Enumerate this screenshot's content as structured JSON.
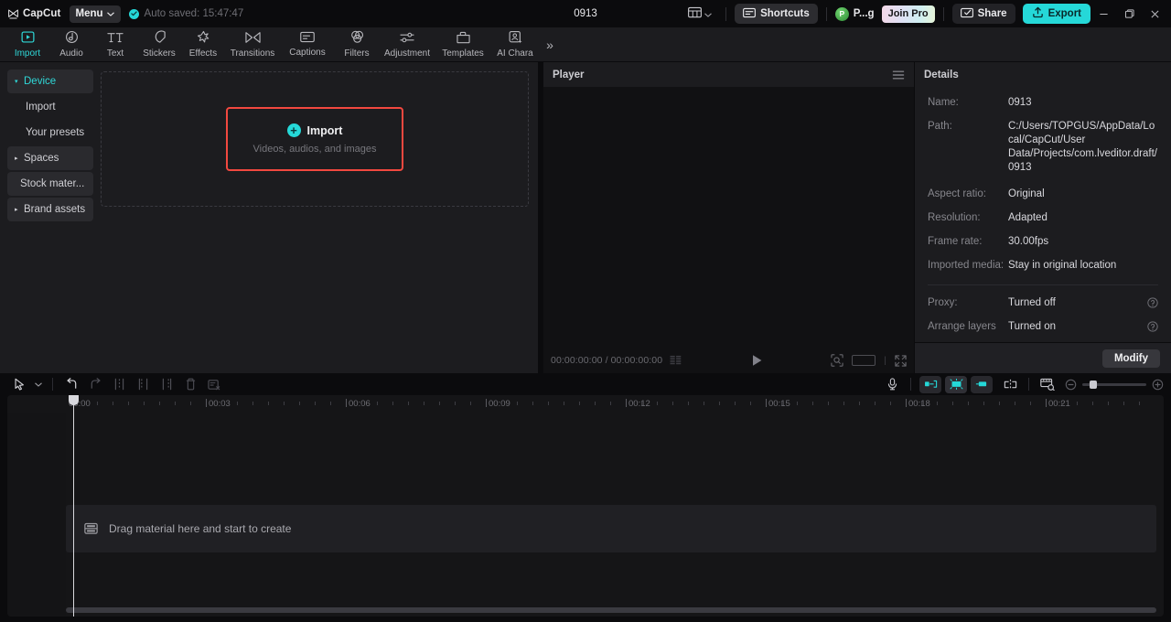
{
  "titlebar": {
    "brand": "CapCut",
    "menu_label": "Menu",
    "autosave_text": "Auto saved: 15:47:47",
    "project_title": "0913",
    "layout_icon": "layout-grid-icon",
    "shortcuts_label": "Shortcuts",
    "profile_initial": "P",
    "profile_name": "P...g",
    "join_pro_label": "Join Pro",
    "share_label": "Share",
    "export_label": "Export",
    "minimize_label": "—",
    "maximize_label": "❐",
    "close_label": "✕"
  },
  "rail": {
    "items": [
      {
        "label": "Import",
        "icon": "import-icon",
        "active": true
      },
      {
        "label": "Audio",
        "icon": "audio-icon",
        "active": false
      },
      {
        "label": "Text",
        "icon": "text-icon",
        "active": false
      },
      {
        "label": "Stickers",
        "icon": "stickers-icon",
        "active": false
      },
      {
        "label": "Effects",
        "icon": "effects-icon",
        "active": false
      },
      {
        "label": "Transitions",
        "icon": "transitions-icon",
        "active": false
      },
      {
        "label": "Captions",
        "icon": "captions-icon",
        "active": false
      },
      {
        "label": "Filters",
        "icon": "filters-icon",
        "active": false
      },
      {
        "label": "Adjustment",
        "icon": "adjustment-icon",
        "active": false
      },
      {
        "label": "Templates",
        "icon": "templates-icon",
        "active": false
      },
      {
        "label": "AI Chara",
        "icon": "ai-character-icon",
        "active": false
      }
    ],
    "more_label": "»"
  },
  "sidebar": {
    "items": [
      {
        "label": "Device",
        "type": "group",
        "expanded": true,
        "selected": true,
        "caret": "▾"
      },
      {
        "label": "Import",
        "type": "sub",
        "expanded": false,
        "selected": false,
        "caret": ""
      },
      {
        "label": "Your presets",
        "type": "sub",
        "expanded": false,
        "selected": false,
        "caret": ""
      },
      {
        "label": "Spaces",
        "type": "group",
        "expanded": false,
        "selected": false,
        "caret": "▸"
      },
      {
        "label": "Stock mater...",
        "type": "groupsub",
        "expanded": false,
        "selected": false,
        "caret": ""
      },
      {
        "label": "Brand assets",
        "type": "group",
        "expanded": false,
        "selected": false,
        "caret": "▸"
      }
    ]
  },
  "import_panel": {
    "button_label": "Import",
    "hint": "Videos, audios, and images",
    "plus_glyph": "+",
    "highlight_color": "#f2483f"
  },
  "player": {
    "title": "Player",
    "menu_icon": "hamburger-icon",
    "current_time": "00:00:00:00",
    "total_time": "00:00:00:00",
    "time_display": "00:00:00:00 / 00:00:00:00",
    "play_icon": "play-icon",
    "quality_icon": "quality-icon",
    "zoom_fit_icon": "zoom-fit-icon",
    "ratio_icon": "aspect-ratio-icon",
    "fullscreen_icon": "fullscreen-icon"
  },
  "details": {
    "title": "Details",
    "rows": [
      {
        "key": "Name:",
        "value": "0913",
        "help": false
      },
      {
        "key": "Path:",
        "value": "C:/Users/TOPGUS/AppData/Local/CapCut/User Data/Projects/com.lveditor.draft/0913",
        "help": false
      },
      {
        "key": "Aspect ratio:",
        "value": "Original",
        "help": false
      },
      {
        "key": "Resolution:",
        "value": "Adapted",
        "help": false
      },
      {
        "key": "Frame rate:",
        "value": "30.00fps",
        "help": false
      },
      {
        "key": "Imported media:",
        "value": "Stay in original location",
        "help": false
      }
    ],
    "rows2": [
      {
        "key": "Proxy:",
        "value": "Turned off",
        "help": true
      },
      {
        "key": "Arrange layers",
        "value": "Turned on",
        "help": true
      }
    ],
    "modify_label": "Modify"
  },
  "timeline": {
    "select_icon": "cursor-select-icon",
    "dropdown_icon": "chevron-down-icon",
    "undo_icon": "undo-icon",
    "redo_icon": "redo-icon",
    "split_icon": "split-icon",
    "trim_left_icon": "trim-left-icon",
    "trim_right_icon": "trim-right-icon",
    "delete_icon": "delete-icon",
    "crop_icon": "crop-icon",
    "mic_icon": "microphone-icon",
    "auto_chip_1_icon": "snap-left-icon",
    "auto_chip_2_icon": "auto-adjust-icon",
    "auto_chip_3_icon": "snap-right-icon",
    "mirror_icon": "mirror-icon",
    "preview_icon": "thumbnail-preview-icon",
    "zoom_out_icon": "zoom-out-icon",
    "zoom_in_icon": "zoom-in-icon",
    "ruler_labels": [
      "00:00",
      "00:03",
      "00:06",
      "00:09",
      "00:12",
      "00:15",
      "00:18",
      "00:21"
    ],
    "drag_hint": "Drag material here and start to create",
    "drag_icon": "media-placeholder-icon",
    "playhead_time": "00:00"
  },
  "colors": {
    "accent": "#25d8d8",
    "highlight": "#f2483f",
    "panel_bg": "#1c1c1f",
    "app_bg": "#0b0b0d",
    "timeline_bg": "#151517"
  }
}
